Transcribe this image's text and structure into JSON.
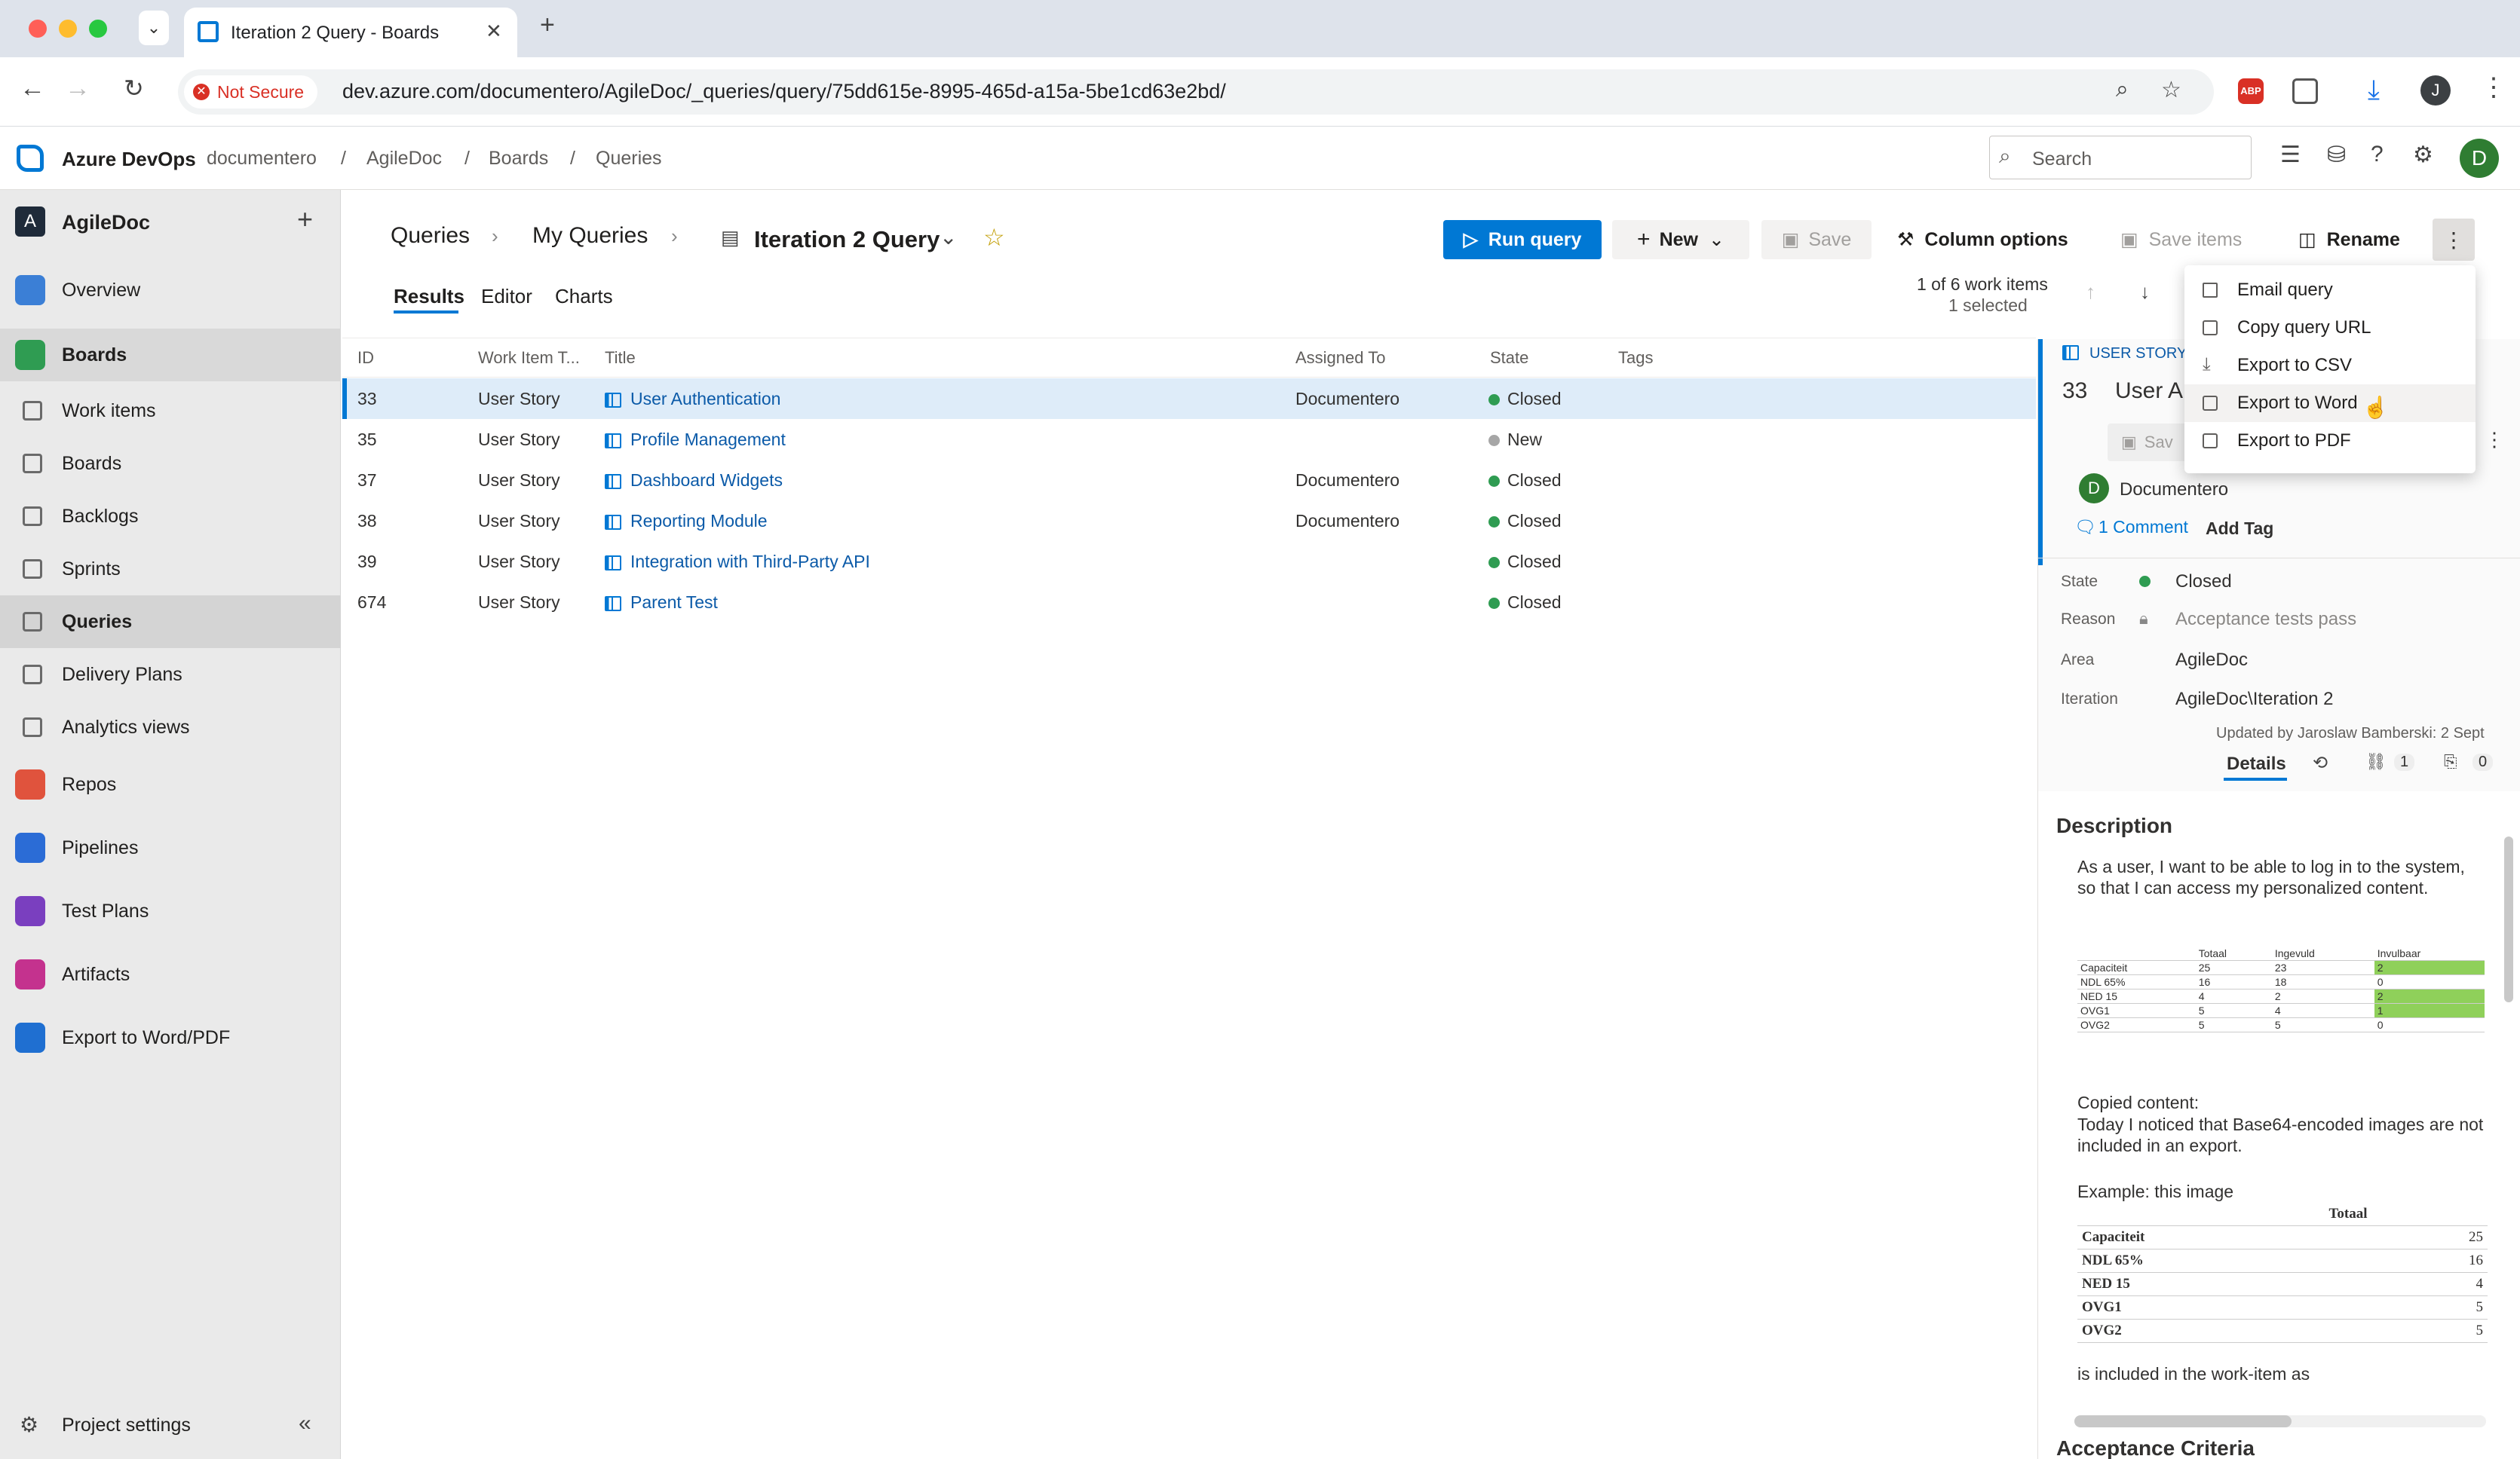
{
  "browser": {
    "tab_title": "Iteration 2 Query - Boards",
    "security": "Not Secure",
    "url": "dev.azure.com/documentero/AgileDoc/_queries/query/75dd615e-8995-465d-a15a-5be1cd63e2bd/",
    "profile_initial": "J"
  },
  "header": {
    "brand": "Azure DevOps",
    "org": "documentero",
    "breadcrumb": [
      "AgileDoc",
      "Boards",
      "Queries"
    ],
    "search_placeholder": "Search",
    "user_initial": "D"
  },
  "sidebar": {
    "project": "AgileDoc",
    "project_initial": "A",
    "items": [
      {
        "label": "Overview",
        "color": "#3b7fd6"
      },
      {
        "label": "Boards",
        "color": "#2f9c52"
      },
      {
        "label": "Work items"
      },
      {
        "label": "Boards"
      },
      {
        "label": "Backlogs"
      },
      {
        "label": "Sprints"
      },
      {
        "label": "Queries"
      },
      {
        "label": "Delivery Plans"
      },
      {
        "label": "Analytics views"
      },
      {
        "label": "Repos",
        "color": "#e0533d"
      },
      {
        "label": "Pipelines",
        "color": "#2b6cd6"
      },
      {
        "label": "Test Plans",
        "color": "#7a3fbf"
      },
      {
        "label": "Artifacts",
        "color": "#c4328e"
      },
      {
        "label": "Export to Word/PDF",
        "color": "#1f6fd1"
      }
    ],
    "settings": "Project settings"
  },
  "page": {
    "crumb1": "Queries",
    "crumb2": "My Queries",
    "query_name": "Iteration 2 Query",
    "run_query": "Run query",
    "new": "New",
    "save": "Save",
    "column_options": "Column options",
    "save_items": "Save items",
    "rename": "Rename",
    "tabs": [
      "Results",
      "Editor",
      "Charts"
    ],
    "count": "1 of 6 work items",
    "selected": "1 selected"
  },
  "grid": {
    "columns": [
      "ID",
      "Work Item T...",
      "Title",
      "Assigned To",
      "State",
      "Tags"
    ],
    "rows": [
      {
        "id": "33",
        "type": "User Story",
        "title": "User Authentication",
        "assigned": "Documentero",
        "state": "Closed"
      },
      {
        "id": "35",
        "type": "User Story",
        "title": "Profile Management",
        "assigned": "",
        "state": "New"
      },
      {
        "id": "37",
        "type": "User Story",
        "title": "Dashboard Widgets",
        "assigned": "Documentero",
        "state": "Closed"
      },
      {
        "id": "38",
        "type": "User Story",
        "title": "Reporting Module",
        "assigned": "Documentero",
        "state": "Closed"
      },
      {
        "id": "39",
        "type": "User Story",
        "title": "Integration with Third-Party API",
        "assigned": "",
        "state": "Closed"
      },
      {
        "id": "674",
        "type": "User Story",
        "title": "Parent Test",
        "assigned": "",
        "state": "Closed"
      }
    ]
  },
  "menu": {
    "items": [
      "Email query",
      "Copy query URL",
      "Export to CSV",
      "Export to Word",
      "Export to PDF"
    ]
  },
  "detail": {
    "type": "USER STORY",
    "id": "33",
    "title_partial": "User A",
    "save_partial": "Sav",
    "assignee": "Documentero",
    "assignee_initial": "D",
    "comments": "1 Comment",
    "add_tag": "Add Tag",
    "state_label": "State",
    "state": "Closed",
    "reason_label": "Reason",
    "reason": "Acceptance tests pass",
    "area_label": "Area",
    "area": "AgileDoc",
    "iteration_label": "Iteration",
    "iteration": "AgileDoc\\Iteration 2",
    "updated": "Updated by Jaroslaw Bamberski: 2 Sept",
    "details_tab": "Details",
    "links_count": "1",
    "attach_count": "0",
    "description_heading": "Description",
    "desc_p1": "As a user, I want to be able to log in to the system, so that I can access my personalized content.",
    "mini_table": {
      "headers": [
        "",
        "Totaal",
        "Ingevuld",
        "Invulbaar"
      ],
      "rows": [
        [
          "Capaciteit",
          "25",
          "23",
          "2"
        ],
        [
          "NDL 65%",
          "16",
          "18",
          "0"
        ],
        [
          "NED 15",
          "4",
          "2",
          "2"
        ],
        [
          "OVG1",
          "5",
          "4",
          "1"
        ],
        [
          "OVG2",
          "5",
          "5",
          "0"
        ]
      ]
    },
    "copied_label": "Copied content:",
    "copied_text": "Today I noticed that Base64-encoded images are not included in an export.",
    "example": "Example: this image",
    "table2": {
      "header": "Totaal",
      "rows": [
        [
          "Capaciteit",
          "25"
        ],
        [
          "NDL 65%",
          "16"
        ],
        [
          "NED 15",
          "4"
        ],
        [
          "OVG1",
          "5"
        ],
        [
          "OVG2",
          "5"
        ]
      ]
    },
    "included": "is included in the work-item as",
    "acceptance_heading": "Acceptance Criteria"
  },
  "colors": {
    "accent": "#0078d4",
    "closed": "#2f9c52",
    "new": "#a6a6a6",
    "green_cell": "#8fd05a"
  }
}
